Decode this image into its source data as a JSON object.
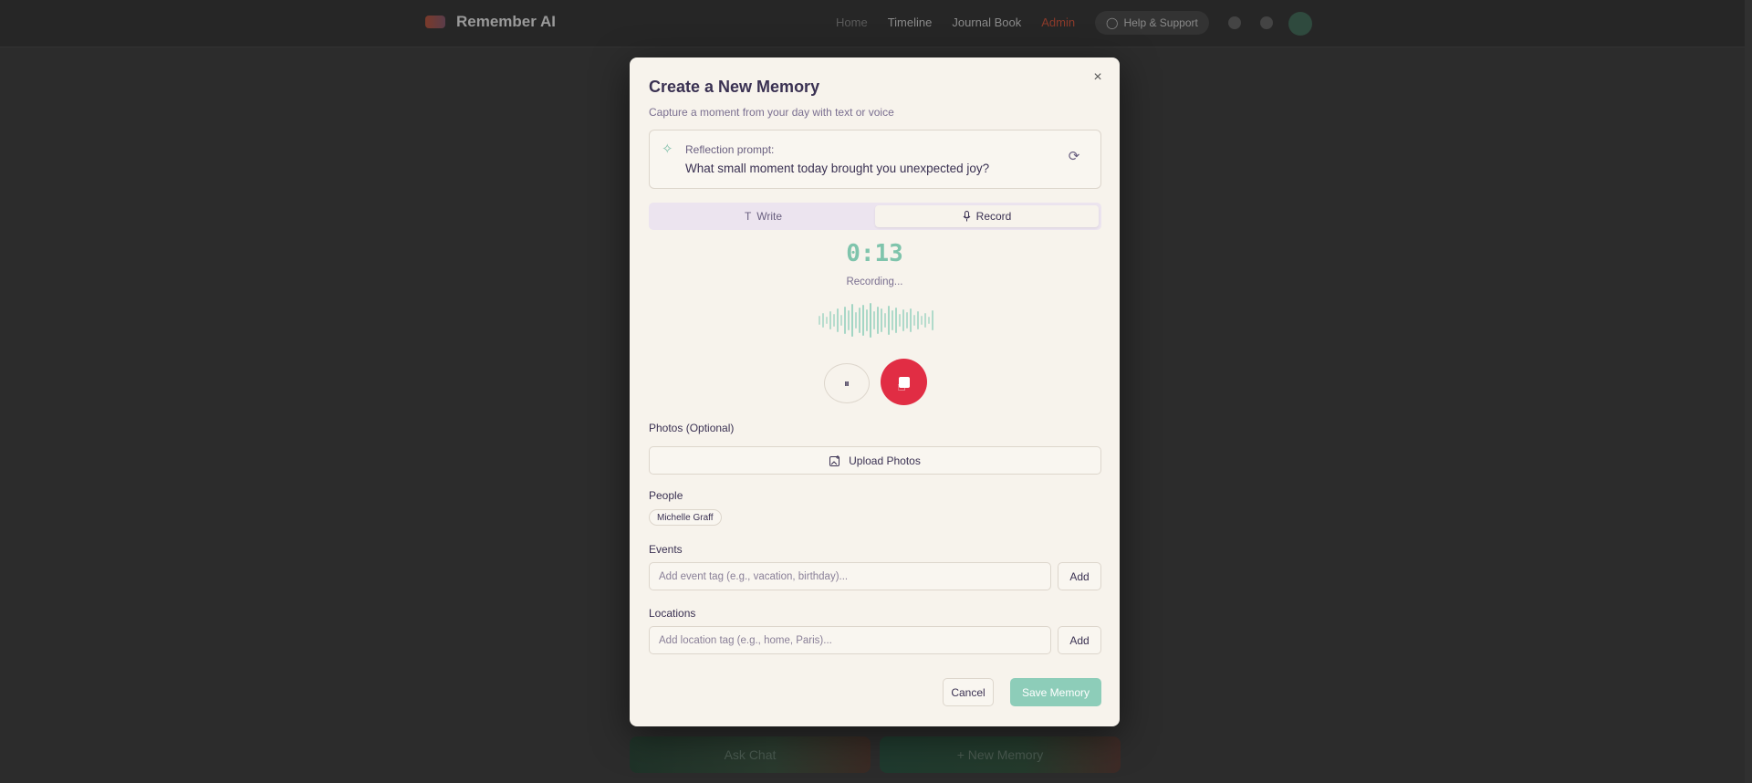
{
  "app": {
    "name": "Remember AI",
    "nav": [
      "Home",
      "Timeline",
      "Journal Book",
      "Admin"
    ],
    "help_label": "Help & Support",
    "bottom_left_label": "Ask Chat",
    "bottom_right_label": "+ New Memory"
  },
  "modal": {
    "title": "Create a New Memory",
    "subtitle": "Capture a moment from your day with text or voice",
    "close_icon": "×",
    "prompt": {
      "label": "Reflection prompt:",
      "text": "What small moment today brought you unexpected joy?"
    },
    "tabs": {
      "write": "Write",
      "record": "Record",
      "active": "Record"
    },
    "recording": {
      "timer": "0:13",
      "status": "Recording..."
    },
    "photos": {
      "label": "Photos (Optional)",
      "upload_label": "Upload Photos"
    },
    "people": {
      "label": "People",
      "chips": [
        "Michelle Graff"
      ]
    },
    "events": {
      "label": "Events",
      "placeholder": "Add event tag (e.g., vacation, birthday)...",
      "add_label": "Add"
    },
    "locations": {
      "label": "Locations",
      "placeholder": "Add location tag (e.g., home, Paris)...",
      "add_label": "Add"
    },
    "actions": {
      "cancel": "Cancel",
      "save": "Save Memory"
    }
  },
  "icons": {
    "sparkle": "sparkle-icon",
    "refresh": "refresh-icon",
    "write": "text-icon",
    "record": "mic-icon",
    "pause": "pause-icon",
    "stop": "stop-icon",
    "upload": "image-plus-icon"
  },
  "colors": {
    "accent": "#8dcdb9",
    "record_red": "#e12d44",
    "title": "#3a3152",
    "modal_bg": "#f7f3ec"
  }
}
